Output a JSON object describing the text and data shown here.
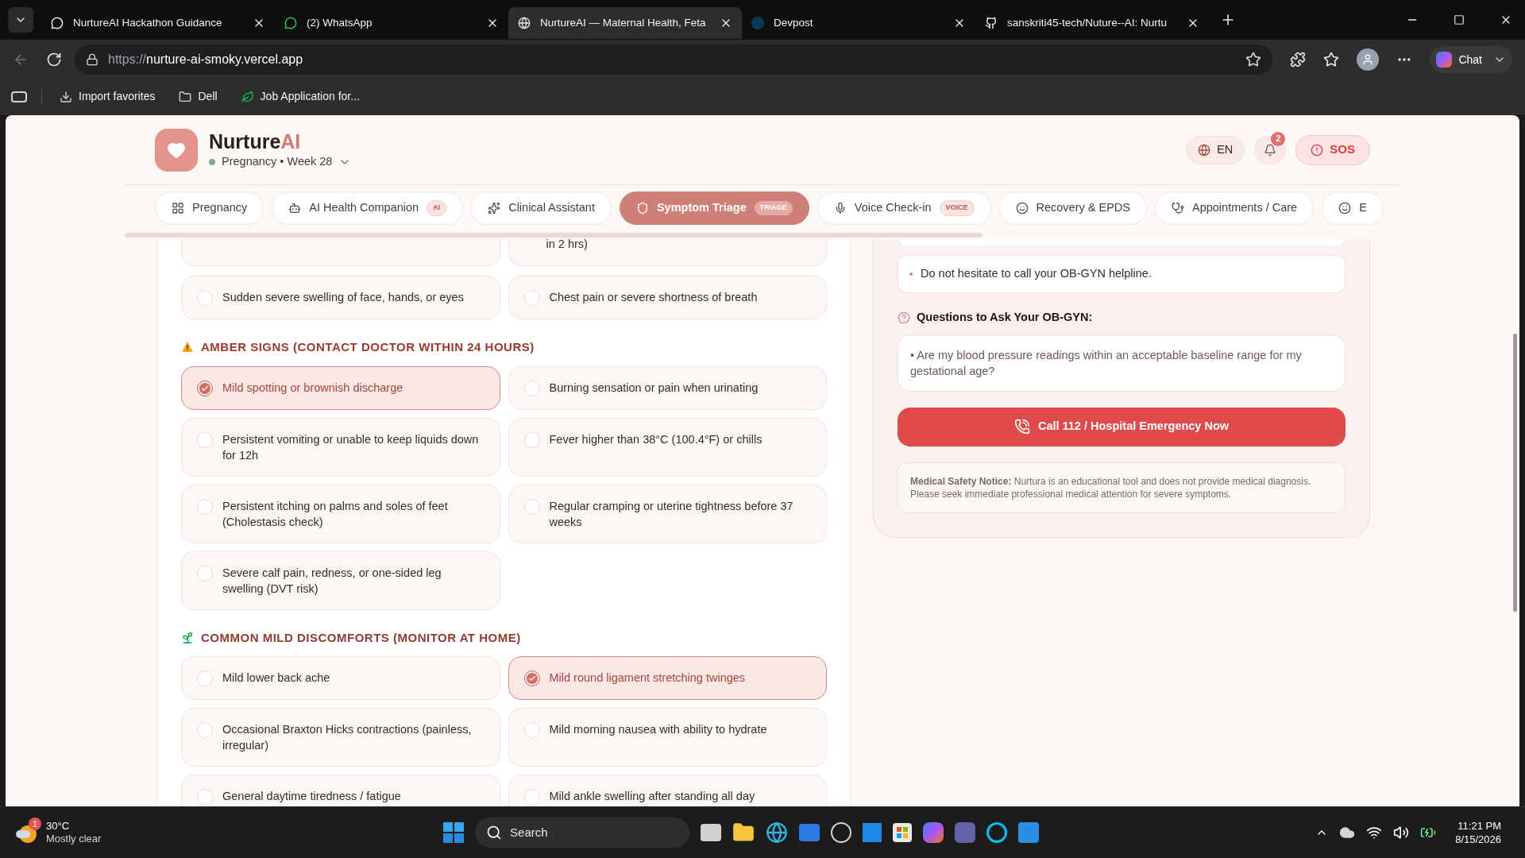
{
  "browser": {
    "tabs": [
      {
        "title": "NurtureAI Hackathon Guidance",
        "selected": false
      },
      {
        "title": "(2) WhatsApp",
        "selected": false
      },
      {
        "title": "NurtureAI — Maternal Health, Feta",
        "selected": true
      },
      {
        "title": "Devpost",
        "selected": false
      },
      {
        "title": "sanskriti45-tech/Nuture--AI: Nurtu",
        "selected": false
      }
    ],
    "url_prefix": "https://",
    "url_host": "nurture-ai-smoky.vercel.app",
    "chat": "Chat",
    "bookmarks": [
      "Import favorites",
      "Dell",
      "Job Application for..."
    ]
  },
  "app": {
    "brand": "Nurture",
    "brand_accent": "AI",
    "status": "Pregnancy • Week 28",
    "language": "EN",
    "notifications": "2",
    "sos": "SOS",
    "nav": [
      {
        "label": "Pregnancy",
        "selected": false
      },
      {
        "label": "AI Health Companion",
        "badge": "AI",
        "selected": false
      },
      {
        "label": "Clinical Assistant",
        "selected": false
      },
      {
        "label": "Symptom Triage",
        "badge": "TRIAGE",
        "selected": true
      },
      {
        "label": "Voice Check-in",
        "badge": "VOICE",
        "selected": false
      },
      {
        "label": "Recovery & EPDS",
        "selected": false
      },
      {
        "label": "Appointments / Care",
        "selected": false
      },
      {
        "label": "E",
        "selected": false
      }
    ]
  },
  "checklist": {
    "cut_row_right": "in 2 hrs)",
    "sections": [
      {
        "items": [
          {
            "text": "Sudden severe swelling of face, hands, or eyes",
            "checked": false
          },
          {
            "text": "Chest pain or severe shortness of breath",
            "checked": false
          }
        ]
      },
      {
        "kind": "amber",
        "title": "AMBER SIGNS (CONTACT DOCTOR WITHIN 24 HOURS)",
        "items": [
          {
            "text": "Mild spotting or brownish discharge",
            "checked": true
          },
          {
            "text": "Burning sensation or pain when urinating",
            "checked": false
          },
          {
            "text": "Persistent vomiting or unable to keep liquids down for 12h",
            "checked": false
          },
          {
            "text": "Fever higher than 38°C (100.4°F) or chills",
            "checked": false
          },
          {
            "text": "Persistent itching on palms and soles of feet (Cholestasis check)",
            "checked": false
          },
          {
            "text": "Regular cramping or uterine tightness before 37 weeks",
            "checked": false
          },
          {
            "text": "Severe calf pain, redness, or one-sided leg swelling (DVT risk)",
            "checked": false
          }
        ]
      },
      {
        "kind": "mild",
        "title": "COMMON MILD DISCOMFORTS (MONITOR AT HOME)",
        "items": [
          {
            "text": "Mild lower back ache",
            "checked": false
          },
          {
            "text": "Mild round ligament stretching twinges",
            "checked": true
          },
          {
            "text": "Occasional Braxton Hicks contractions (painless, irregular)",
            "checked": false
          },
          {
            "text": "Mild morning nausea with ability to hydrate",
            "checked": false
          },
          {
            "text": "General daytime tiredness / fatigue",
            "checked": false
          },
          {
            "text": "Mild ankle swelling after standing all day",
            "checked": false
          }
        ]
      }
    ]
  },
  "guidance": {
    "advice": [
      "Do not hesitate to call your OB-GYN helpline."
    ],
    "questions_title": "Questions to Ask Your OB-GYN:",
    "questions": [
      "• Are my blood pressure readings within an acceptable baseline range for my gestational age?"
    ],
    "call_button": "Call 112 / Hospital Emergency Now",
    "notice": "**Medical Safety Notice:** Nurtura is an educational tool and does not provide medical diagnosis. Please seek immediate professional medical attention for severe symptoms."
  },
  "taskbar": {
    "temperature": "30°C",
    "weather": "Mostly clear",
    "weather_badge": "1",
    "search": "Search",
    "time": "11:21 PM",
    "date": "8/15/2026"
  }
}
